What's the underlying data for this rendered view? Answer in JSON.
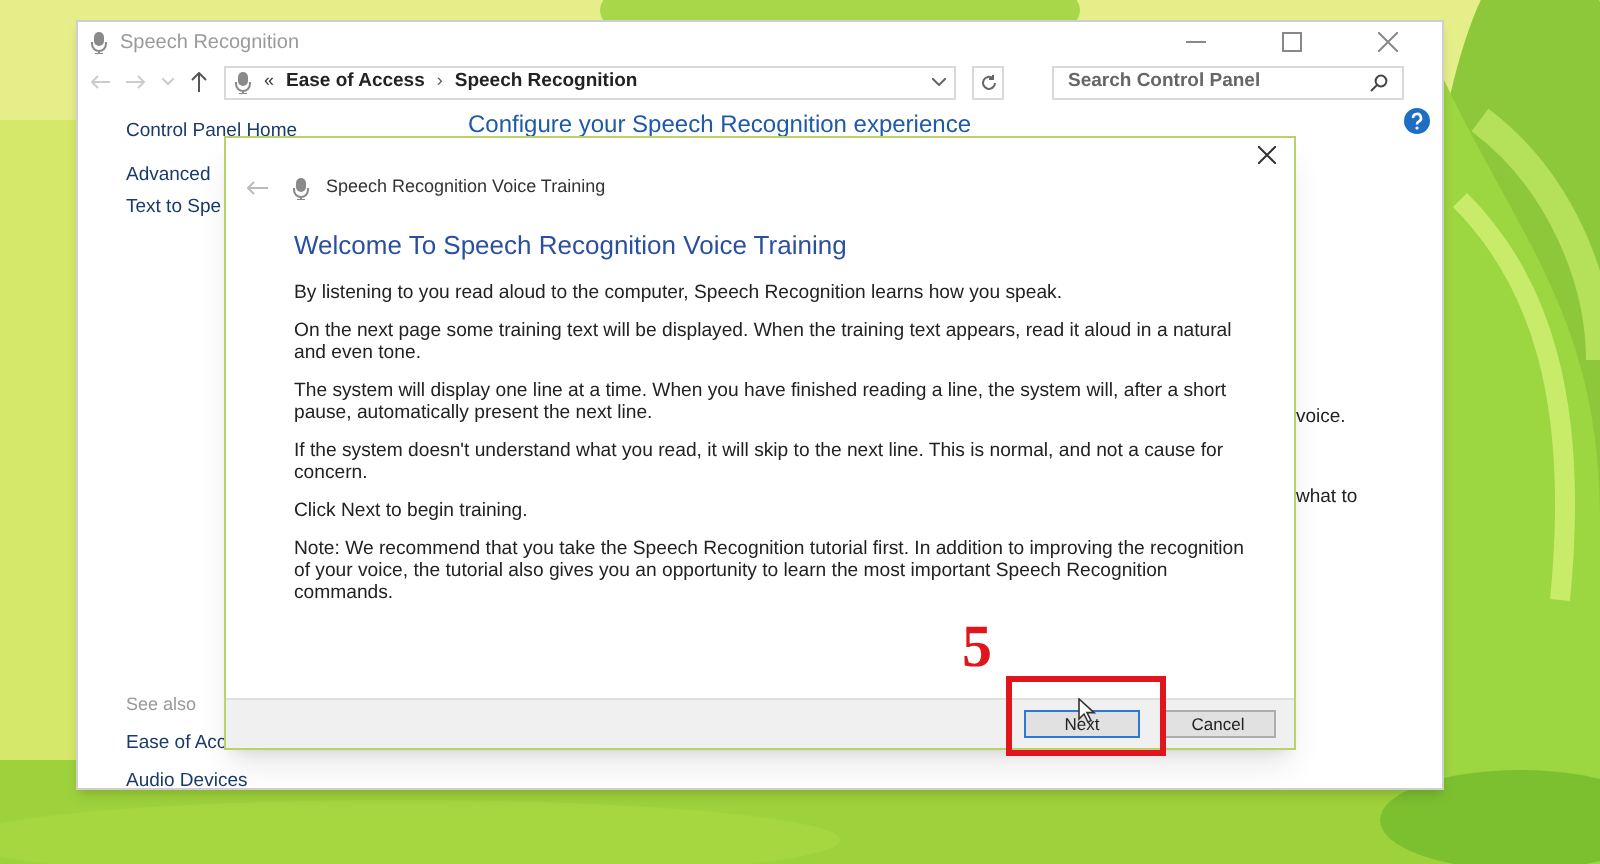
{
  "window": {
    "title": "Speech Recognition",
    "breadcrumb_prefix": "«",
    "breadcrumb": [
      "Ease of Access",
      "Speech Recognition"
    ],
    "separator": "›",
    "search": {
      "placeholder": "Search Control Panel"
    }
  },
  "sidebar": {
    "links": [
      "Control Panel Home",
      "Advanced",
      "Text to Spe"
    ],
    "see_also_title": "See also",
    "see_also": [
      "Ease of Acc",
      "Audio Devices"
    ]
  },
  "content": {
    "heading": "Configure your Speech Recognition experience",
    "fragments": [
      "voice.",
      "what to"
    ]
  },
  "dialog": {
    "title": "Speech Recognition Voice Training",
    "heading": "Welcome To Speech Recognition Voice Training",
    "paragraphs": [
      "By listening to you read aloud to the computer, Speech Recognition learns how you speak.",
      "On the next page some training text will be displayed. When the training text appears, read it aloud in a natural and even tone.",
      "The system will display one line at a time. When you have finished reading a line, the system will, after a short pause, automatically present the next line.",
      "If the system doesn't understand what you read, it will skip to the next line. This is normal, and not a cause for concern.",
      "Click Next to begin training.",
      "Note: We recommend that you take the Speech Recognition tutorial first. In addition to improving the recognition of your voice, the tutorial also gives you an opportunity to learn the most important Speech Recognition commands."
    ],
    "buttons": [
      {
        "label": "Next",
        "default": true
      },
      {
        "label": "Cancel",
        "default": false
      }
    ]
  },
  "annotation": {
    "text": "5"
  }
}
